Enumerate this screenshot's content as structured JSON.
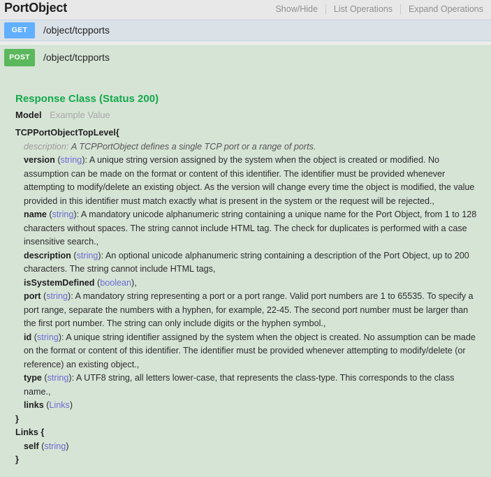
{
  "header": {
    "title": "PortObject",
    "options": [
      {
        "label": "Show/Hide",
        "name": "show-hide"
      },
      {
        "label": "List Operations",
        "name": "list-operations"
      },
      {
        "label": "Expand Operations",
        "name": "expand-operations"
      }
    ]
  },
  "operations": [
    {
      "method": "GET",
      "path": "/object/tcpports",
      "color": "#61affe",
      "row_bg": "#dae2e8"
    },
    {
      "method": "POST",
      "path": "/object/tcpports",
      "color": "#5cb85c",
      "row_bg": "#d6e4d6"
    }
  ],
  "response": {
    "class_title": "Response Class (Status 200)",
    "tabs": [
      {
        "label": "Model",
        "active": true
      },
      {
        "label": "Example Value",
        "active": false
      }
    ],
    "models": [
      {
        "name": "TCPPortObjectTopLevel",
        "open_brace": "{",
        "close_brace": "}",
        "description_label": "description:",
        "description_text": "A TCPPortObject defines a single TCP port or a range of ports.",
        "properties": [
          {
            "name": "version",
            "type": "string",
            "text": ": A unique string version assigned by the system when the object is created or modified. No assumption can be made on the format or content of this identifier. The identifier must be provided whenever attempting to modify/delete an existing object. As the version will change every time the object is modified, the value provided in this identifier must match exactly what is present in the system or the request will be rejected.,"
          },
          {
            "name": "name",
            "type": "string",
            "text": ": A mandatory unicode alphanumeric string containing a unique name for the Port Object, from 1 to 128 characters without spaces. The string cannot include HTML tag. The check for duplicates is performed with a case insensitive search.,"
          },
          {
            "name": "description",
            "type": "string",
            "text": ": An optional unicode alphanumeric string containing a description of the Port Object, up to 200 characters. The string cannot include HTML tags,"
          },
          {
            "name": "isSystemDefined",
            "type": "boolean",
            "text": ","
          },
          {
            "name": "port",
            "type": "string",
            "text": ": A mandatory string representing a port or a port range. Valid port numbers are 1 to 65535. To specify a port range, separate the numbers with a hyphen, for example, 22-45. The second port number must be larger than the first port number. The string can only include digits or the hyphen symbol.,"
          },
          {
            "name": "id",
            "type": "string",
            "text": ": A unique string identifier assigned by the system when the object is created. No assumption can be made on the format or content of this identifier. The identifier must be provided whenever attempting to modify/delete (or reference) an existing object.,"
          },
          {
            "name": "type",
            "type": "string",
            "text": ": A UTF8 string, all letters lower-case, that represents the class-type. This corresponds to the class name.,"
          },
          {
            "name": "links",
            "type": "Links",
            "text": ""
          }
        ]
      },
      {
        "name": "Links",
        "open_brace": "{",
        "close_brace": "}",
        "description_label": "",
        "description_text": "",
        "properties": [
          {
            "name": "self",
            "type": "string",
            "text": ""
          }
        ]
      }
    ]
  }
}
